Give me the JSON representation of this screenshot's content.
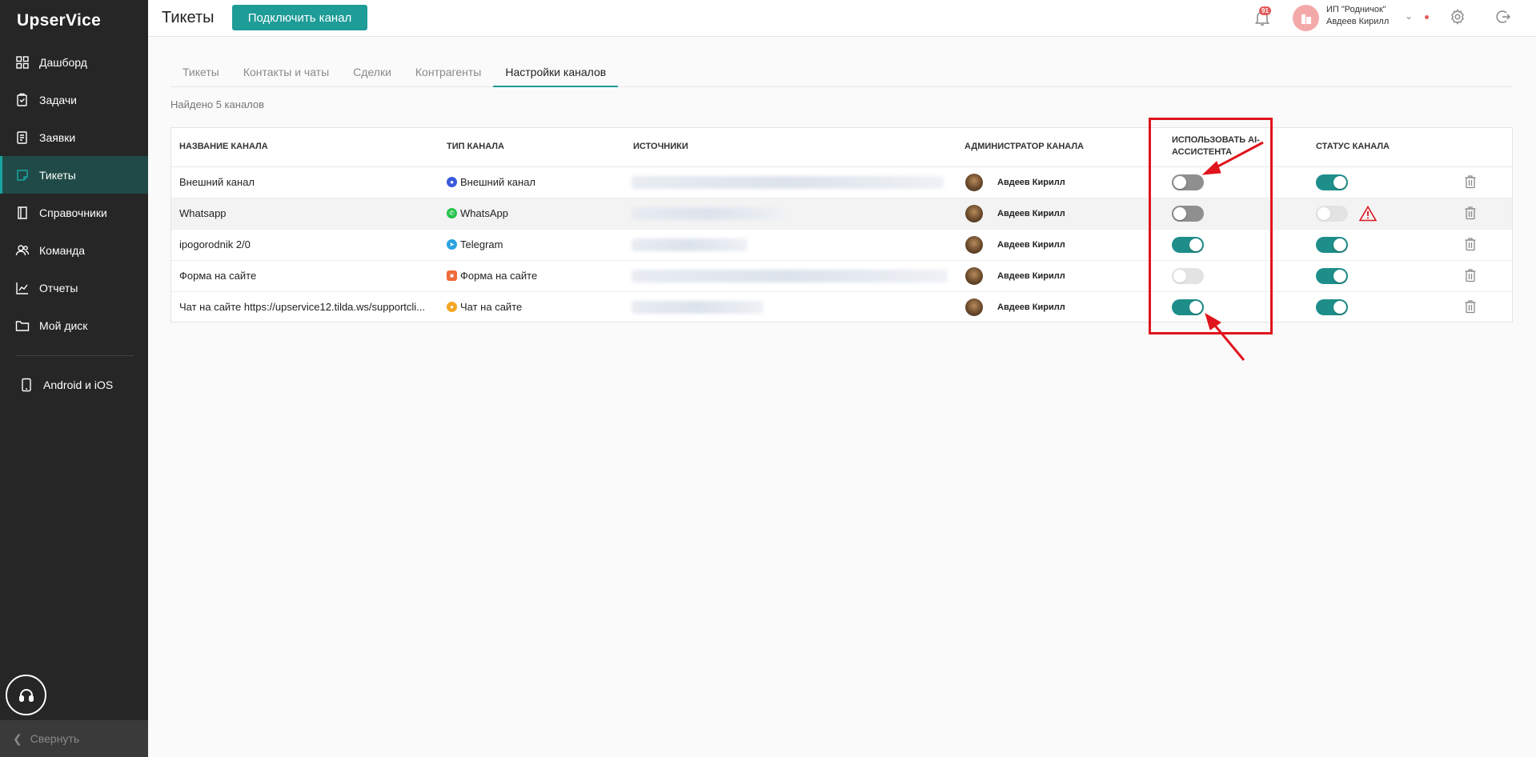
{
  "app": {
    "logo": "UpserVice"
  },
  "sidebar": {
    "items": [
      {
        "label": "Дашборд",
        "icon": "dashboard-icon"
      },
      {
        "label": "Задачи",
        "icon": "tasks-icon"
      },
      {
        "label": "Заявки",
        "icon": "requests-icon"
      },
      {
        "label": "Тикеты",
        "icon": "tickets-icon",
        "active": true
      },
      {
        "label": "Справочники",
        "icon": "book-icon"
      },
      {
        "label": "Команда",
        "icon": "team-icon"
      },
      {
        "label": "Отчеты",
        "icon": "reports-icon"
      },
      {
        "label": "Мой диск",
        "icon": "folder-icon"
      }
    ],
    "mobile": "Android и iOS",
    "collapse": "Свернуть"
  },
  "header": {
    "title": "Тикеты",
    "connect_button": "Подключить канал",
    "notifications_count": "91",
    "org_name": "ИП \"Родничок\"",
    "user_name": "Авдеев Кирилл"
  },
  "tabs": [
    {
      "label": "Тикеты",
      "active": false
    },
    {
      "label": "Контакты и чаты",
      "active": false
    },
    {
      "label": "Сделки",
      "active": false
    },
    {
      "label": "Контрагенты",
      "active": false
    },
    {
      "label": "Настройки каналов",
      "active": true
    }
  ],
  "found_text": "Найдено 5 каналов",
  "table": {
    "headers": {
      "name": "Название канала",
      "type": "Тип канала",
      "sources": "Источники",
      "admin": "Администратор канала",
      "ai": "Использовать AI-ассистента",
      "status": "Статус канала"
    },
    "rows": [
      {
        "name": "Внешний канал",
        "type": "Внешний канал",
        "type_icon": "external-icon",
        "admin": "Авдеев Кирилл",
        "ai": "off",
        "status": "on",
        "warning": false
      },
      {
        "name": "Whatsapp",
        "type": "WhatsApp",
        "type_icon": "whatsapp-icon",
        "admin": "Авдеев Кирилл",
        "ai": "off",
        "status": "disabled",
        "warning": true
      },
      {
        "name": "ipogorodnik 2/0",
        "type": "Telegram",
        "type_icon": "telegram-icon",
        "admin": "Авдеев Кирилл",
        "ai": "on",
        "status": "on",
        "warning": false
      },
      {
        "name": "Форма на сайте",
        "type": "Форма на сайте",
        "type_icon": "form-icon",
        "admin": "Авдеев Кирилл",
        "ai": "disabled",
        "status": "on",
        "warning": false
      },
      {
        "name": "Чат на сайте https://upservice12.tilda.ws/supportcli...",
        "type": "Чат на сайте",
        "type_icon": "chat-icon",
        "admin": "Авдеев Кирилл",
        "ai": "on",
        "status": "on",
        "warning": false
      }
    ]
  },
  "colors": {
    "accent": "#1e9c98",
    "sidebar_bg": "#262626",
    "annotation": "#e0141c"
  }
}
